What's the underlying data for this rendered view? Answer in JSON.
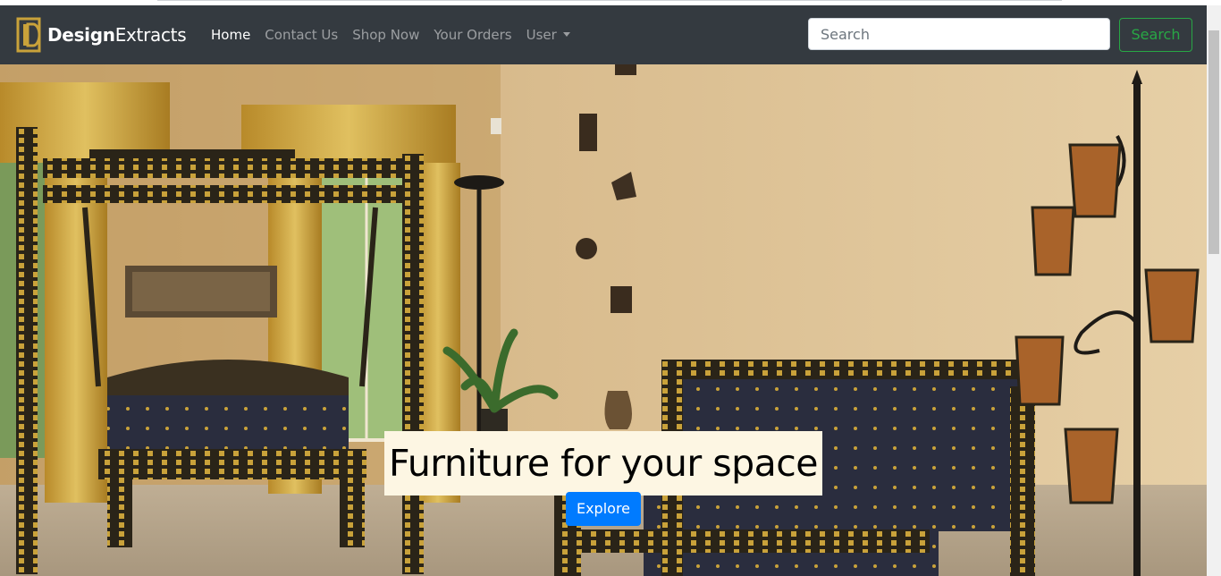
{
  "brand": {
    "name_bold": "Design",
    "name_light": "Extracts",
    "logo_icon": "de-monogram-logo",
    "logo_color": "#c9a23a"
  },
  "nav": {
    "items": [
      {
        "label": "Home",
        "active": true
      },
      {
        "label": "Contact Us",
        "active": false
      },
      {
        "label": "Shop Now",
        "active": false
      },
      {
        "label": "Your Orders",
        "active": false
      },
      {
        "label": "User",
        "active": false,
        "dropdown": true
      }
    ]
  },
  "search": {
    "placeholder": "Search",
    "value": "",
    "button_label": "Search"
  },
  "hero": {
    "headline": "Furniture for your space",
    "button_label": "Explore",
    "image_description_icon": "living-room-photo"
  },
  "colors": {
    "navbar_bg": "#343a40",
    "search_button": "#28a745",
    "explore_button": "#007bff",
    "caption_bg": "#fdf6e3"
  }
}
